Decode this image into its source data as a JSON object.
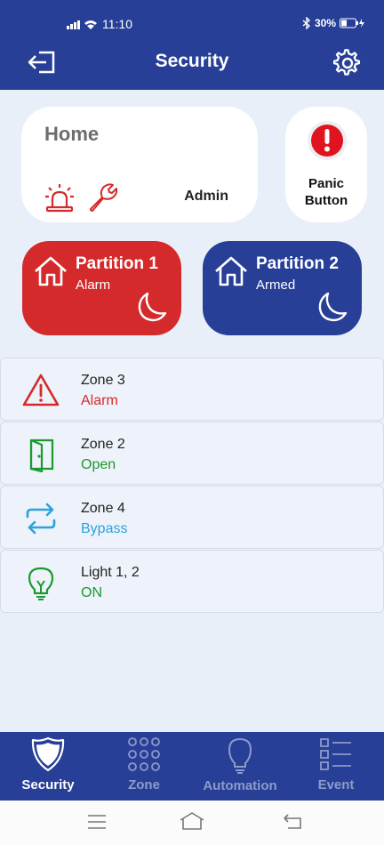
{
  "status_bar": {
    "time": "11:10",
    "battery": "30%"
  },
  "header": {
    "title": "Security"
  },
  "home_card": {
    "title": "Home",
    "role": "Admin"
  },
  "panic": {
    "line1": "Panic",
    "line2": "Button"
  },
  "partitions": [
    {
      "name": "Partition 1",
      "state": "Alarm",
      "color": "#d42a2b"
    },
    {
      "name": "Partition 2",
      "state": "Armed",
      "color": "#273f97"
    }
  ],
  "rows": [
    {
      "name": "Zone 3",
      "state": "Alarm",
      "state_color": "#d42a2b",
      "icon": "warning-icon"
    },
    {
      "name": "Zone 2",
      "state": "Open",
      "state_color": "#1a9a2e",
      "icon": "door-open-icon"
    },
    {
      "name": "Zone 4",
      "state": "Bypass",
      "state_color": "#29a3dc",
      "icon": "bypass-arrows-icon"
    },
    {
      "name": "Light 1, 2",
      "state": "ON",
      "state_color": "#1a9a2e",
      "icon": "lightbulb-icon"
    }
  ],
  "tabs": [
    {
      "label": "Security",
      "active": true
    },
    {
      "label": "Zone",
      "active": false
    },
    {
      "label": "Automation",
      "active": false
    },
    {
      "label": "Event",
      "active": false
    }
  ],
  "colors": {
    "primary": "#273f97",
    "alarm": "#d42a2b",
    "background": "#e9eff9"
  }
}
